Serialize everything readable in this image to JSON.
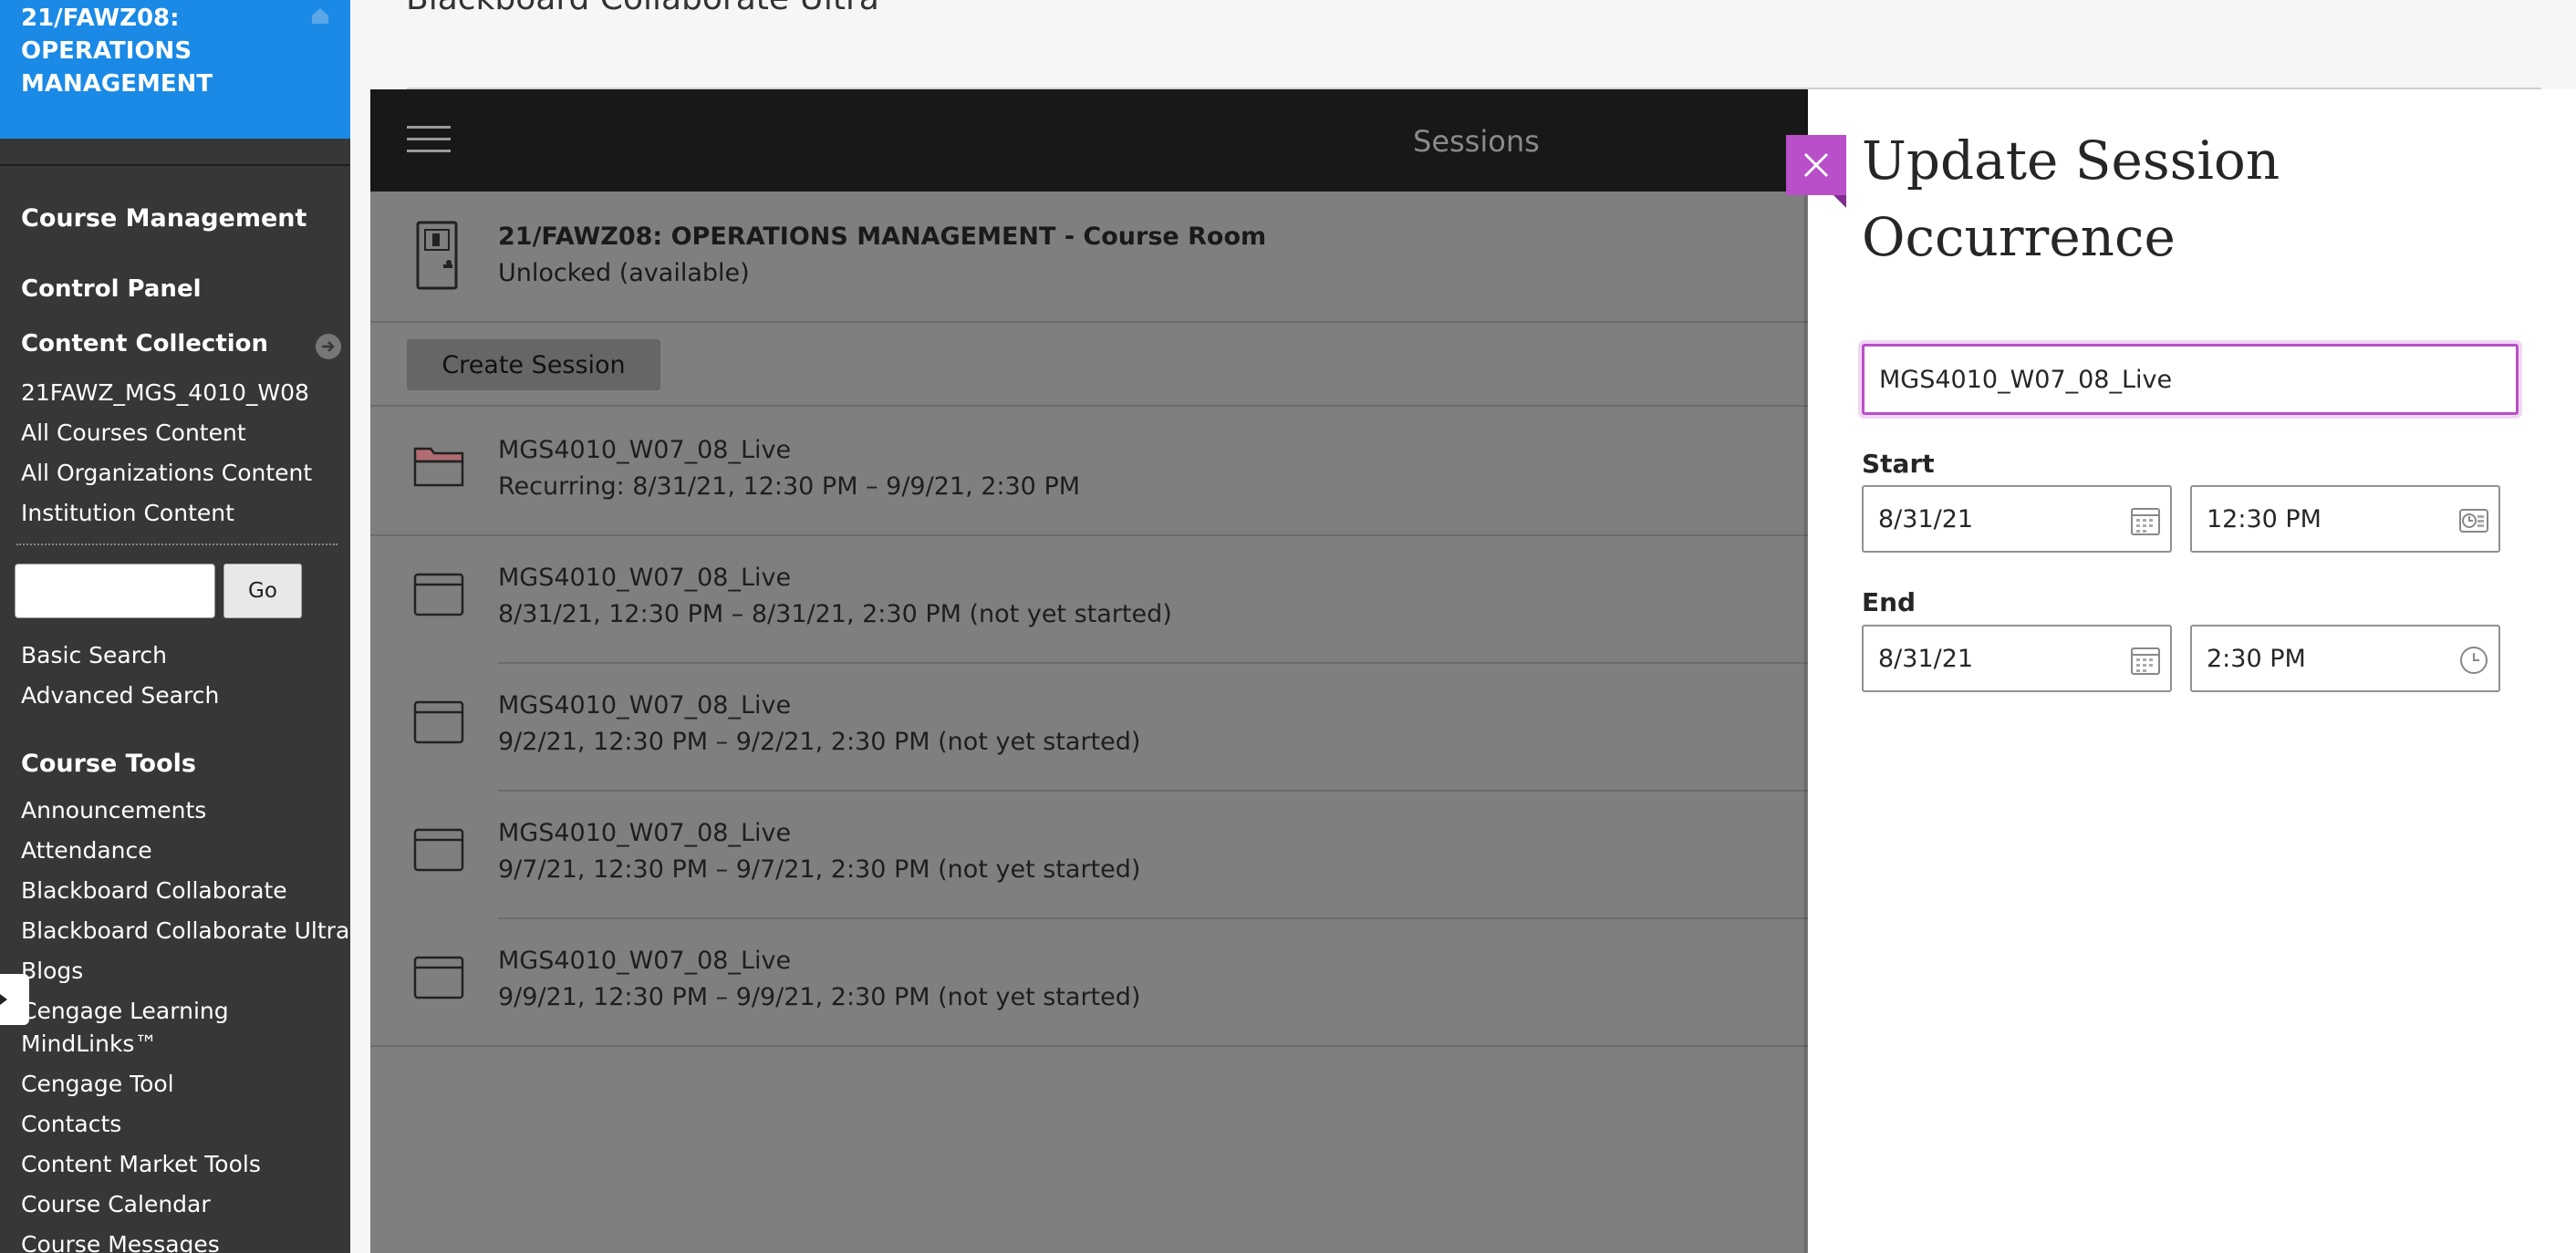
{
  "course_menu": {
    "course_title": "21/FAWZ08: OPERATIONS MANAGEMENT",
    "course_management": "Course Management",
    "control_panel": "Control Panel",
    "content_collection": "Content Collection",
    "content_links": [
      "21FAWZ_MGS_4010_W08",
      "All Courses Content",
      "All Organizations Content",
      "Institution Content"
    ],
    "search_value": "",
    "go_label": "Go",
    "search_links": [
      "Basic Search",
      "Advanced Search"
    ],
    "course_tools": "Course Tools",
    "tool_links": [
      "Announcements",
      "Attendance",
      "Blackboard Collaborate",
      "Blackboard Collaborate Ultra",
      "Blogs",
      "Cengage Learning",
      "MindLinks™",
      "Cengage Tool",
      "Contacts",
      "Content Market Tools",
      "Course Calendar",
      "Course Messages"
    ]
  },
  "frame": {
    "title": "Blackboard Collaborate Ultra"
  },
  "sessions": {
    "header_title": "Sessions",
    "course_room": {
      "title": "21/FAWZ08: OPERATIONS MANAGEMENT - Course Room",
      "status": "Unlocked (available)"
    },
    "create_label": "Create Session",
    "items": [
      {
        "name": "MGS4010_W07_08_Live",
        "time": "Recurring: 8/31/21, 12:30 PM – 9/9/21, 2:30 PM",
        "icon": "folder-icon"
      },
      {
        "name": "MGS4010_W07_08_Live",
        "time": "8/31/21, 12:30 PM – 8/31/21, 2:30 PM (not yet started)",
        "icon": "calendar-icon"
      },
      {
        "name": "MGS4010_W07_08_Live",
        "time": "9/2/21, 12:30 PM – 9/2/21, 2:30 PM (not yet started)",
        "icon": "calendar-icon"
      },
      {
        "name": "MGS4010_W07_08_Live",
        "time": "9/7/21, 12:30 PM – 9/7/21, 2:30 PM (not yet started)",
        "icon": "calendar-icon"
      },
      {
        "name": "MGS4010_W07_08_Live",
        "time": "9/9/21, 12:30 PM – 9/9/21, 2:30 PM (not yet started)",
        "icon": "calendar-icon"
      }
    ]
  },
  "update_panel": {
    "title": "Update Session Occurrence",
    "session_name_value": "MGS4010_W07_08_Live",
    "start_label": "Start",
    "start_date": "8/31/21",
    "start_time": "12:30 PM",
    "end_label": "End",
    "end_date": "8/31/21",
    "end_time": "2:30 PM",
    "accent_color": "#b94fc9"
  }
}
